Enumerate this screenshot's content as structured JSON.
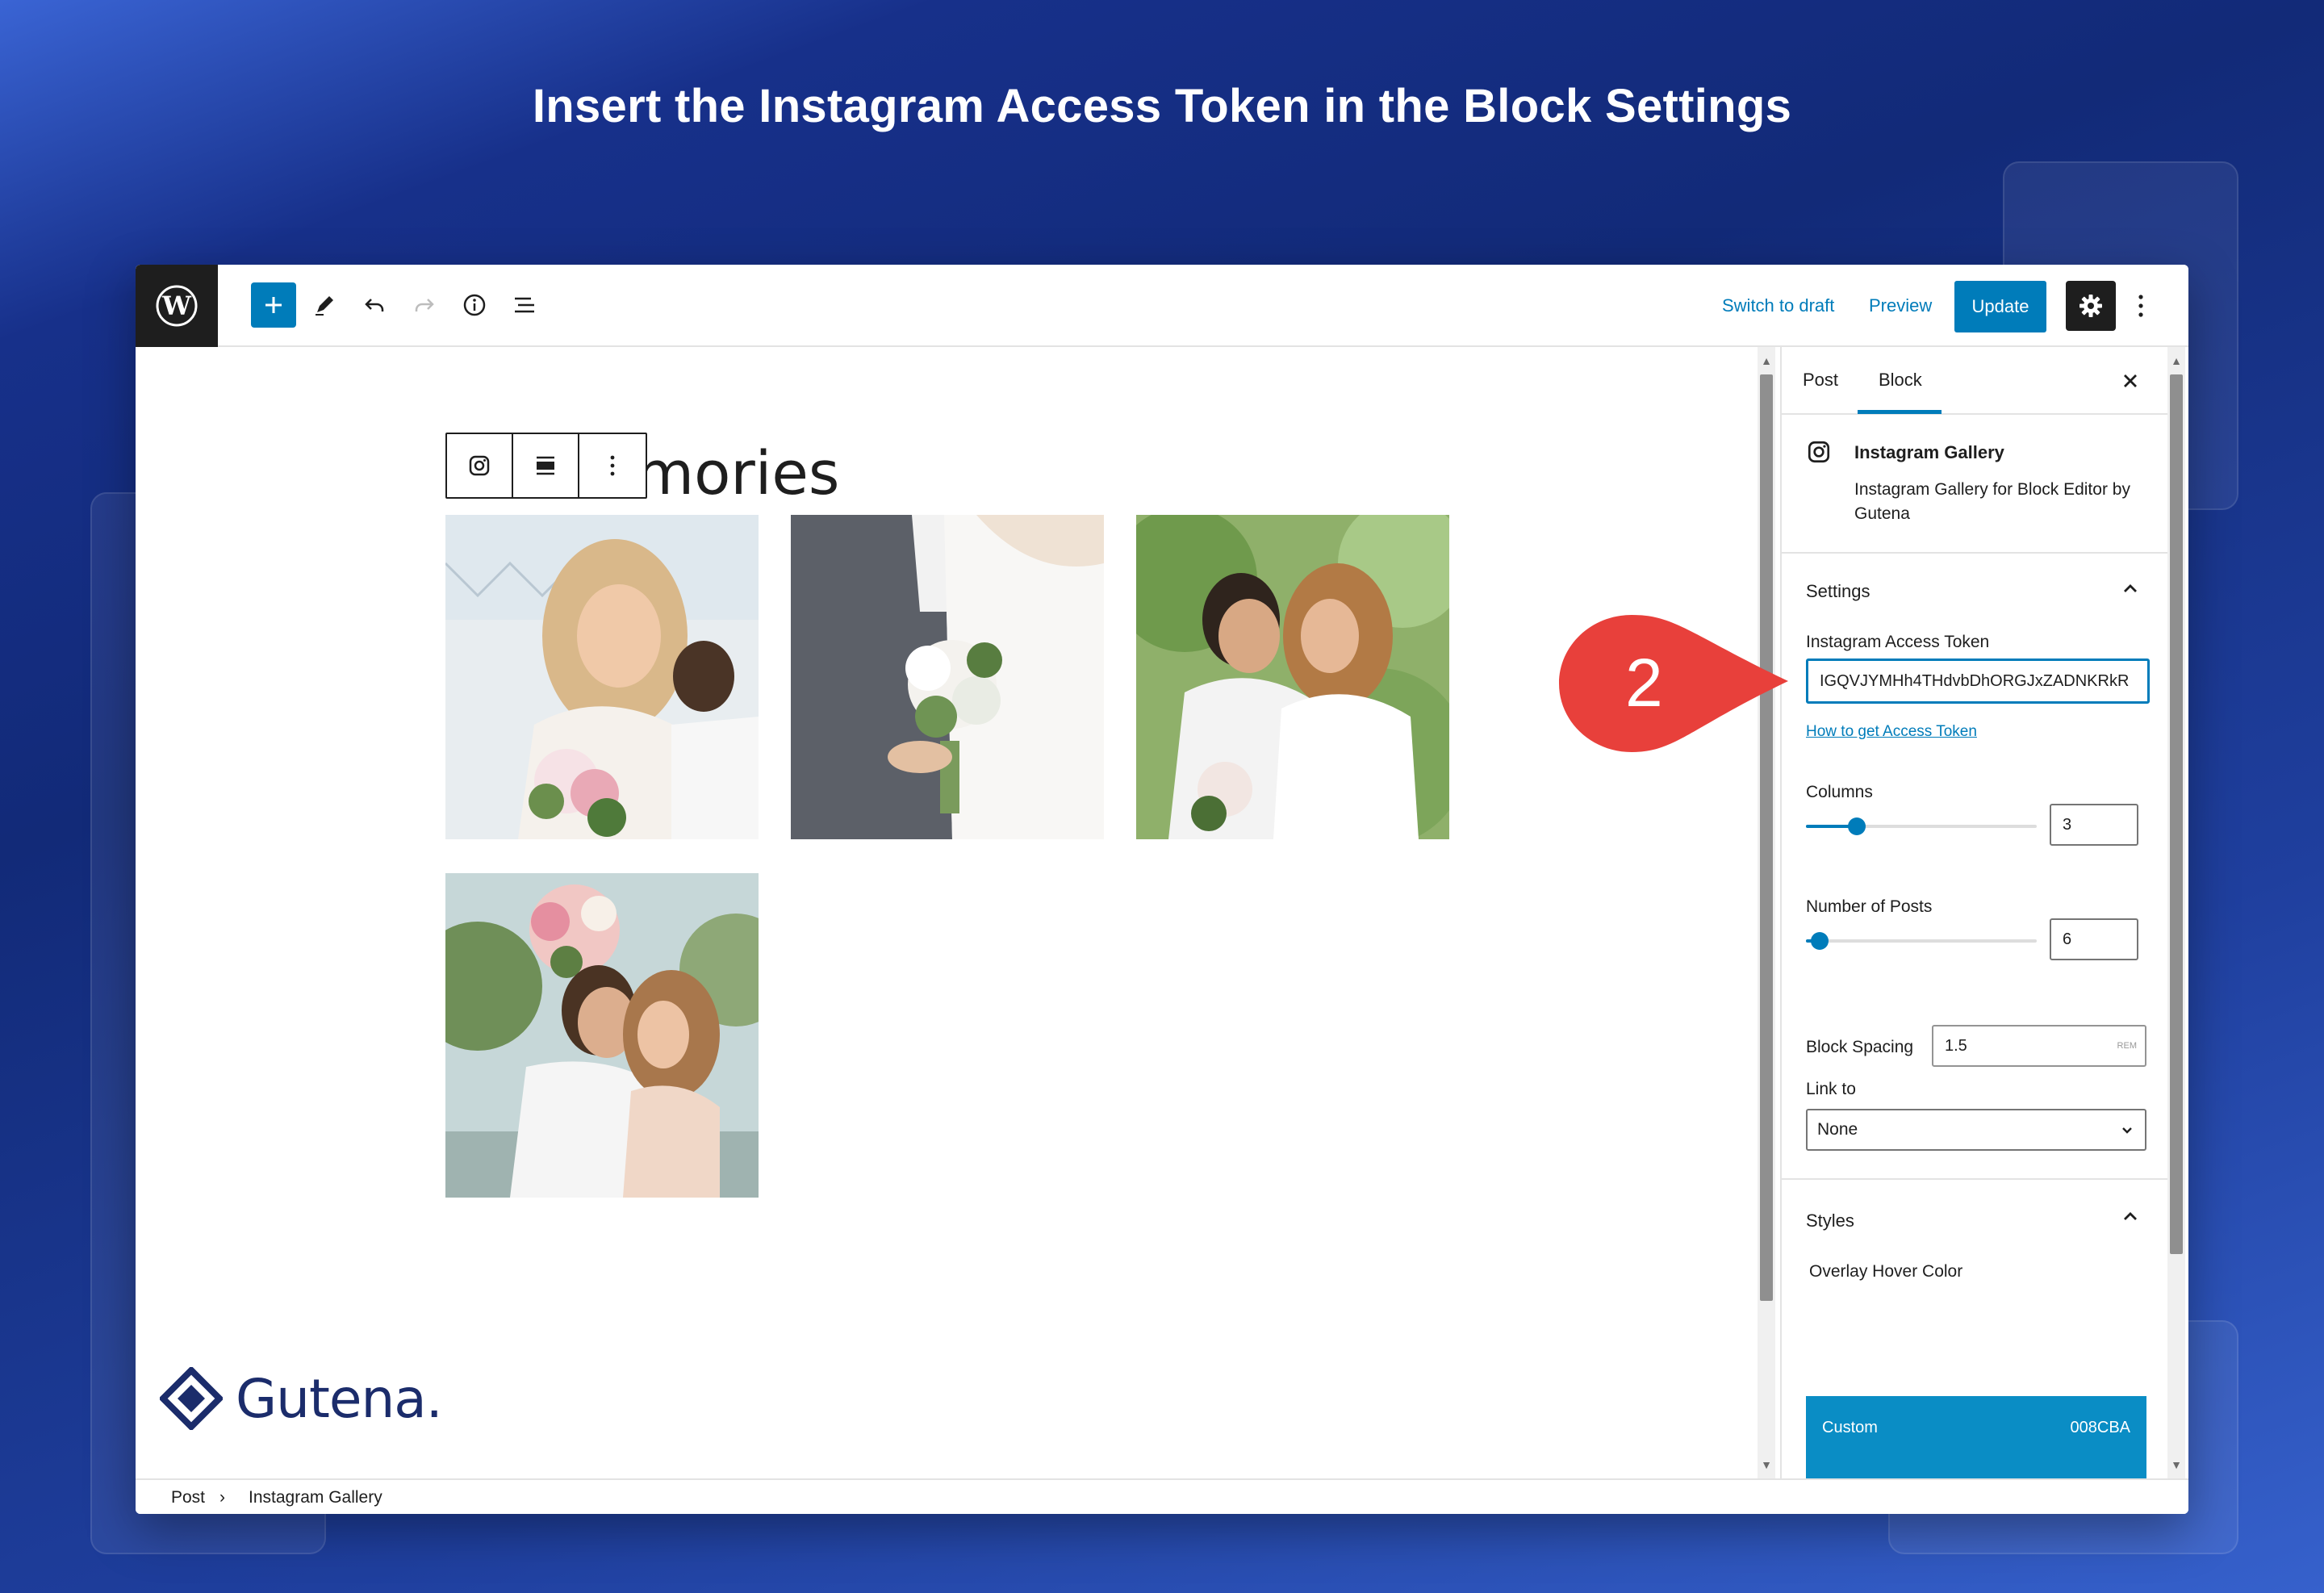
{
  "headline": "Insert the Instagram Access Token in the Block Settings",
  "topbar": {
    "switch_to_draft": "Switch to draft",
    "preview": "Preview",
    "update": "Update"
  },
  "editor": {
    "post_title_visible": "mories",
    "brand_name": "Gutena."
  },
  "sidebar": {
    "tabs": [
      "Post",
      "Block"
    ],
    "active_tab": "Block",
    "block": {
      "title": "Instagram Gallery",
      "description": "Instagram Gallery for Block Editor by Gutena"
    },
    "settings": {
      "heading": "Settings",
      "token_label": "Instagram Access Token",
      "token_value": "IGQVJYMHh4THdvbDhORGJxZADNKRkR",
      "help_link": "How to get Access Token",
      "columns_label": "Columns",
      "columns_value": "3",
      "columns_fraction": 0.22,
      "posts_label": "Number of Posts",
      "posts_value": "6",
      "posts_fraction": 0.06,
      "spacing_label": "Block Spacing",
      "spacing_value": "1.5",
      "spacing_unit": "REM",
      "link_label": "Link to",
      "link_value": "None"
    },
    "styles": {
      "heading": "Styles",
      "overlay_label": "Overlay Hover Color",
      "color_name": "Custom",
      "color_hex": "008CBA",
      "swatches": [
        "#ffffff",
        "#3b6fe0",
        "#222a40",
        "#525a78",
        "#e4edfb",
        "#e8654a"
      ]
    }
  },
  "breadcrumb": [
    "Post",
    "Instagram Gallery"
  ],
  "callout_number": "2",
  "colors": {
    "accent": "#007cba",
    "callout": "#e8403b",
    "brand": "#1b2c6b"
  }
}
